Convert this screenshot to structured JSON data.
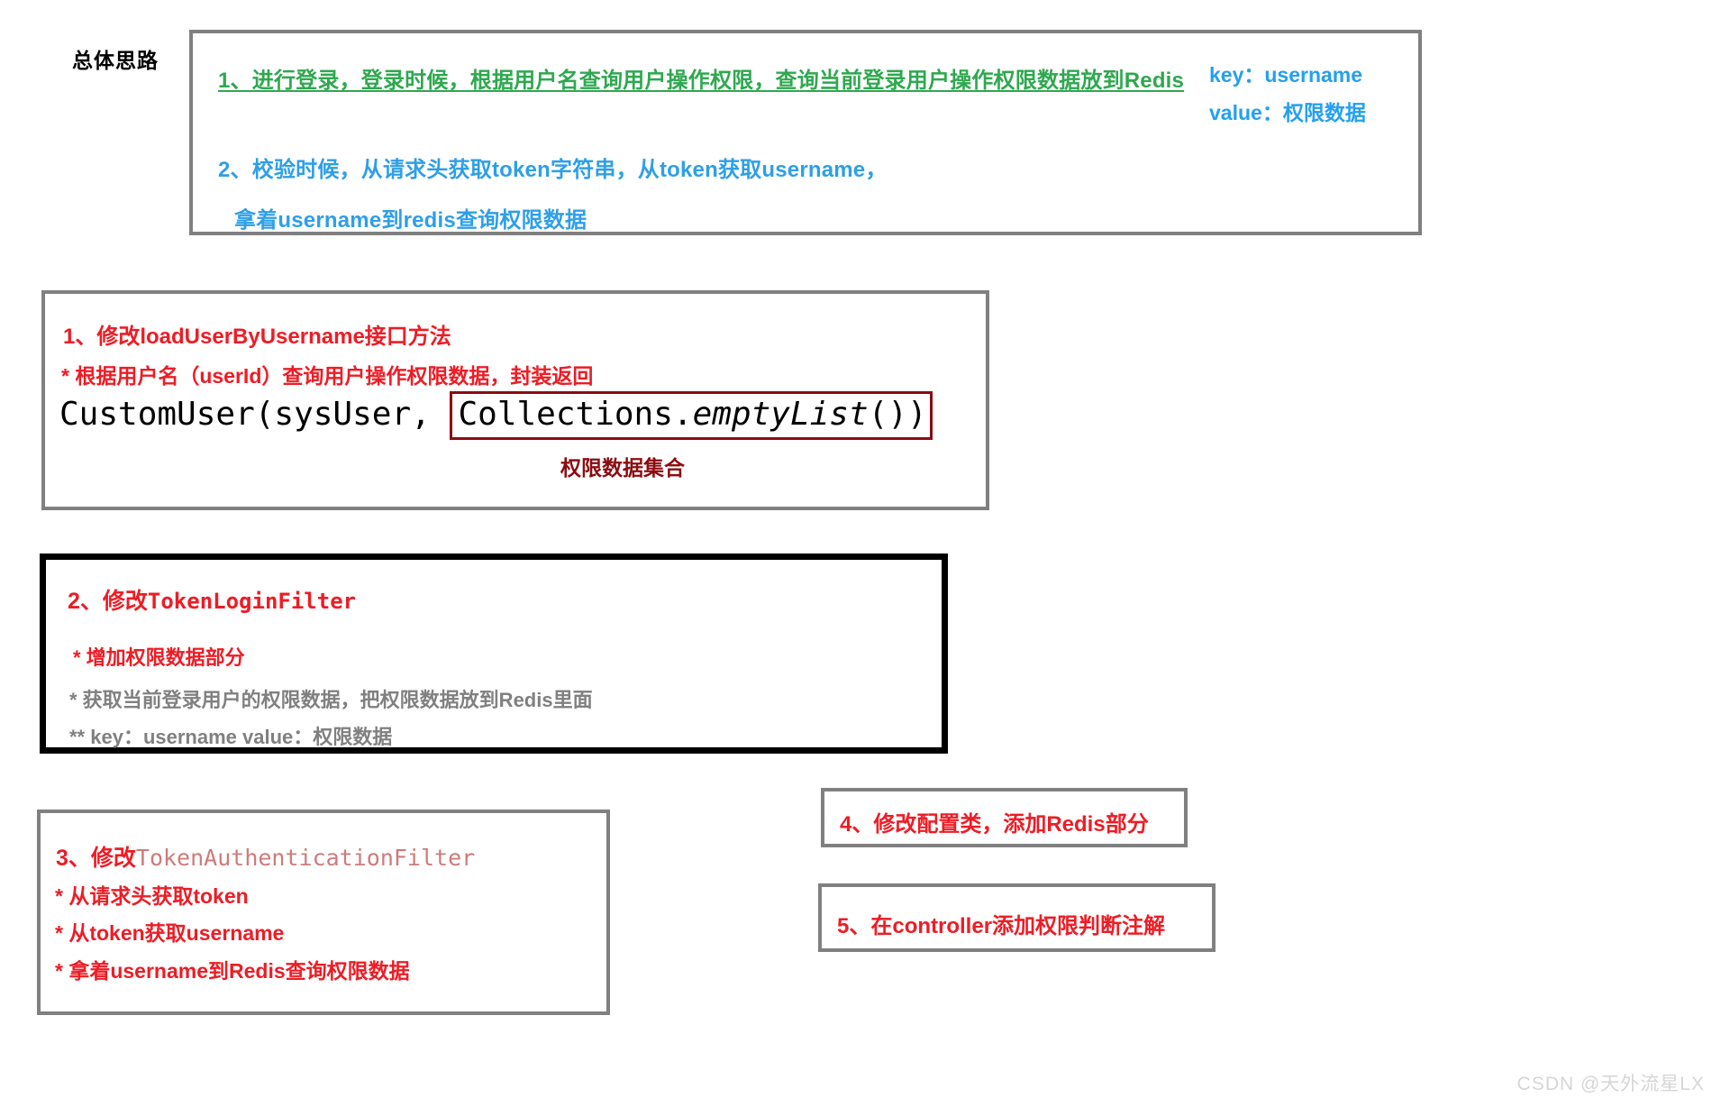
{
  "overall": {
    "label": "总体思路",
    "line1": "1、进行登录，登录时候，根据用户名查询用户操作权限，查询当前登录用户操作权限数据放到Redis",
    "kv_key": "key：username",
    "kv_value": "value：权限数据",
    "line2": "2、校验时候，从请求头获取token字符串，从token获取username，",
    "line3": "拿着username到redis查询权限数据"
  },
  "step1": {
    "title": "1、修改loadUserByUsername接口方法",
    "subtitle": "* 根据用户名（userId）查询用户操作权限数据，封装返回",
    "code_prefix": "CustomUser(sysUser, ",
    "code_boxed_a": "Collections.",
    "code_boxed_b": "emptyList",
    "code_boxed_c": "())",
    "caption": "权限数据集合"
  },
  "step2": {
    "title_prefix": "2、修改",
    "title_mono": "TokenLoginFilter",
    "sub1": "* 增加权限数据部分",
    "sub2": "* 获取当前登录用户的权限数据，把权限数据放到Redis里面",
    "sub3": "** key：username   value：权限数据"
  },
  "step3": {
    "title_prefix": "3、修改",
    "title_mono": "TokenAuthenticationFilter",
    "lines": [
      "* 从请求头获取token",
      "* 从token获取username",
      "* 拿着username到Redis查询权限数据"
    ]
  },
  "step4": {
    "text": "4、修改配置类，添加Redis部分"
  },
  "step5": {
    "text": "5、在controller添加权限判断注解"
  },
  "watermark": {
    "text": "CSDN @天外流星LX"
  },
  "colors": {
    "green": "#2fa84f",
    "blue": "#2e9fe8",
    "light_blue": "#23a0f0",
    "red": "#ee1c25",
    "dark_red": "#8b0c10",
    "gray_text": "#808080",
    "mono_gray_red": "#cf7b7b",
    "border_gray": "#808080",
    "border_black": "#000000",
    "watermark": "#d6d6d6",
    "background": "#ffffff"
  }
}
